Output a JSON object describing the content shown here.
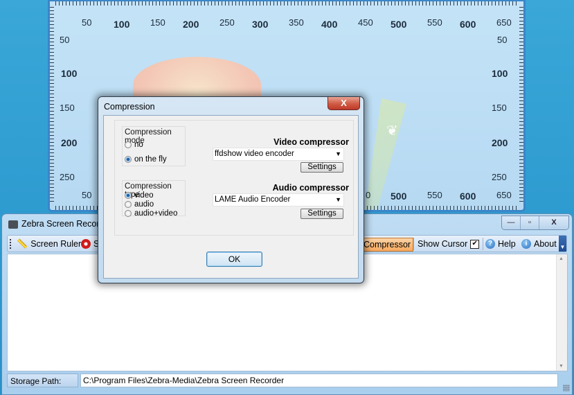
{
  "ruler": {
    "top_labels": [
      "50",
      "100",
      "150",
      "200",
      "250",
      "300",
      "350",
      "400",
      "450",
      "500",
      "550",
      "600",
      "650"
    ],
    "left_labels": [
      "50",
      "100",
      "150",
      "200",
      "250"
    ],
    "right_labels": [
      "50",
      "100",
      "150",
      "200",
      "250"
    ],
    "bottom_labels": [
      "50",
      "500",
      "550",
      "600",
      "650"
    ],
    "bottom_partial_label": "0"
  },
  "app": {
    "title": "Zebra Screen Recorder",
    "caption_buttons": {
      "minimize": "—",
      "maximize": "▫",
      "close": "X"
    },
    "toolbar": {
      "screen_ruler": "Screen Ruler",
      "record_partial": "S",
      "compressor": "Compressor",
      "show_cursor": "Show Cursor",
      "show_cursor_checked": true,
      "help": "Help",
      "about": "About"
    },
    "storage_path_label": "Storage Path:",
    "storage_path_value": "C:\\Program Files\\Zebra-Media\\Zebra Screen Recorder"
  },
  "dialog": {
    "title": "Compression",
    "close_label": "X",
    "compression_mode": {
      "label": "Compression mode",
      "options": [
        "no",
        "on the fly"
      ],
      "selected": "on the fly"
    },
    "compression_type": {
      "label": "Compression type",
      "options": [
        "video",
        "audio",
        "audio+video"
      ],
      "selected": "video"
    },
    "video_compressor": {
      "label": "Video compressor",
      "value": "ffdshow video encoder",
      "settings_label": "Settings"
    },
    "audio_compressor": {
      "label": "Audio compressor",
      "value": "LAME Audio Encoder",
      "settings_label": "Settings"
    },
    "ok_label": "OK"
  }
}
